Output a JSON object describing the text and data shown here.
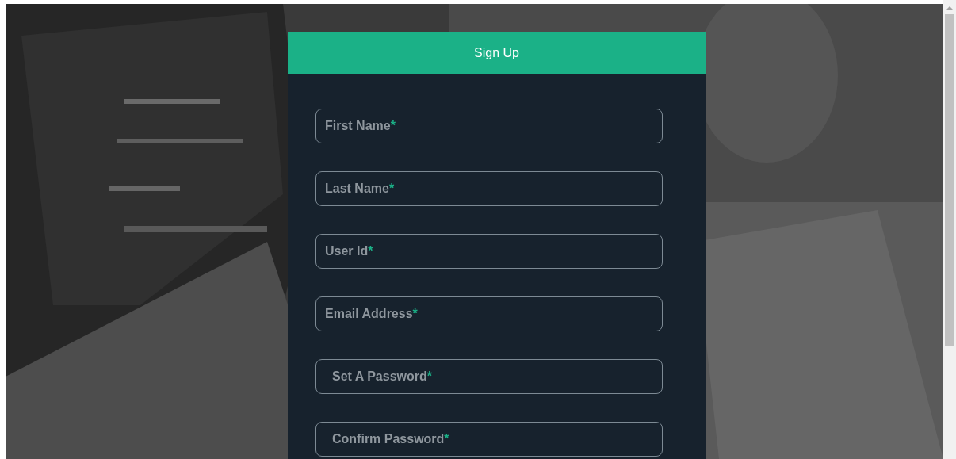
{
  "form": {
    "title": "Sign Up",
    "fields": [
      {
        "label": "First Name",
        "mark": "*",
        "kind": "text"
      },
      {
        "label": "Last Name",
        "mark": "*",
        "kind": "text"
      },
      {
        "label": "User Id",
        "mark": "*",
        "kind": "text"
      },
      {
        "label": "Email Address",
        "mark": "*",
        "kind": "text"
      },
      {
        "label": "Set A Password",
        "mark": "*",
        "kind": "password"
      },
      {
        "label": "Confirm Password",
        "mark": "*",
        "kind": "password"
      }
    ]
  }
}
